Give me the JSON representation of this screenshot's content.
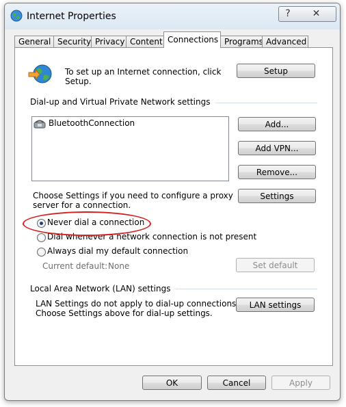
{
  "window": {
    "title": "Internet Properties",
    "help_label": "?",
    "close_label": "✕"
  },
  "tabs": [
    {
      "label": "General"
    },
    {
      "label": "Security"
    },
    {
      "label": "Privacy"
    },
    {
      "label": "Content"
    },
    {
      "label": "Connections",
      "active": true
    },
    {
      "label": "Programs"
    },
    {
      "label": "Advanced"
    }
  ],
  "setup": {
    "text_line1": "To set up an Internet connection, click",
    "text_line2": "Setup.",
    "button_label": "Setup"
  },
  "dialup": {
    "section_label": "Dial-up and Virtual Private Network settings",
    "connections": [
      "BluetoothConnection"
    ],
    "add_label": "Add...",
    "add_vpn_label": "Add VPN...",
    "remove_label": "Remove...",
    "proxy_text_line1": "Choose Settings if you need to configure a proxy",
    "proxy_text_line2": "server for a connection.",
    "settings_label": "Settings",
    "options": [
      {
        "label": "Never dial a connection",
        "checked": true
      },
      {
        "label": "Dial whenever a network connection is not present",
        "checked": false
      },
      {
        "label": "Always dial my default connection",
        "checked": false
      }
    ],
    "current_default_label": "Current default:",
    "current_default_value": "None",
    "set_default_label": "Set default"
  },
  "lan": {
    "section_label": "Local Area Network (LAN) settings",
    "text_line1": "LAN Settings do not apply to dial-up connections.",
    "text_line2": "Choose Settings above for dial-up settings.",
    "button_label": "LAN settings"
  },
  "footer": {
    "ok_label": "OK",
    "cancel_label": "Cancel",
    "apply_label": "Apply"
  },
  "colors": {
    "annotation_ellipse": "#d81f1f",
    "radio_dot": "#1e3f6f"
  }
}
